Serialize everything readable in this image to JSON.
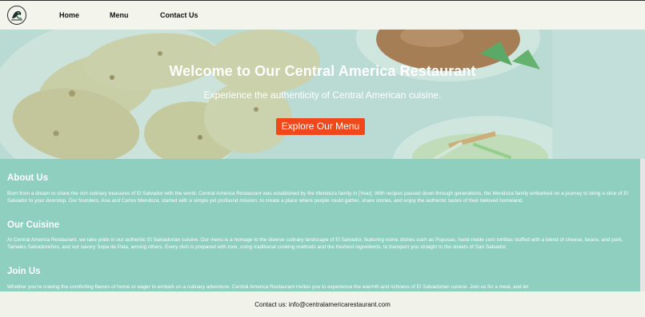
{
  "nav": {
    "links": [
      "Home",
      "Menu",
      "Contact Us"
    ]
  },
  "hero": {
    "title": "Welcome to Our Central America Restaurant",
    "subtitle": "Experience the authenticity of Central American cuisine.",
    "button_label": "Explore Our Menu"
  },
  "sections": [
    {
      "heading": "About Us",
      "body": "Born from a dream to share the rich culinary treasures of El Salvador with the world, Central America Restaurant was established by the Mendoza family in [Year]. With recipes passed down through generations, the Mendoza family embarked on a journey to bring a slice of El Salvador to your doorstep. Our founders, Ana and Carlos Mendoza, started with a simple yet profound mission: to create a place where people could gather, share stories, and enjoy the authentic tastes of their beloved homeland."
    },
    {
      "heading": "Our Cuisine",
      "body": "At Central America Restaurant, we take pride in our authentic El Salvadorian cuisine. Our menu is a homage to the diverse culinary landscape of El Salvador, featuring iconic dishes such as Pupusas, hand-made corn tortillas stuffed with a blend of cheese, beans, and pork, Tamales Salvadoreños, and our savory Sopa de Pata, among others. Every dish is prepared with love, using traditional cooking methods and the freshest ingredients, to transport you straight to the streets of San Salvador."
    },
    {
      "heading": "Join Us",
      "body": "Whether you're craving the comforting flavors of home or eager to embark on a culinary adventure, Central America Restaurant invites you to experience the warmth and richness of El Salvadorian cuisine. Join us for a meal, and let"
    }
  ],
  "footer": {
    "contact_text": "Contact us: info@centralamericarestaurant.com"
  },
  "colors": {
    "accent_button": "#f0471b",
    "content_background": "#8ecfbf",
    "nav_background": "#f3f4ec"
  },
  "icons": {
    "logo": "restaurant-logo-icon"
  }
}
